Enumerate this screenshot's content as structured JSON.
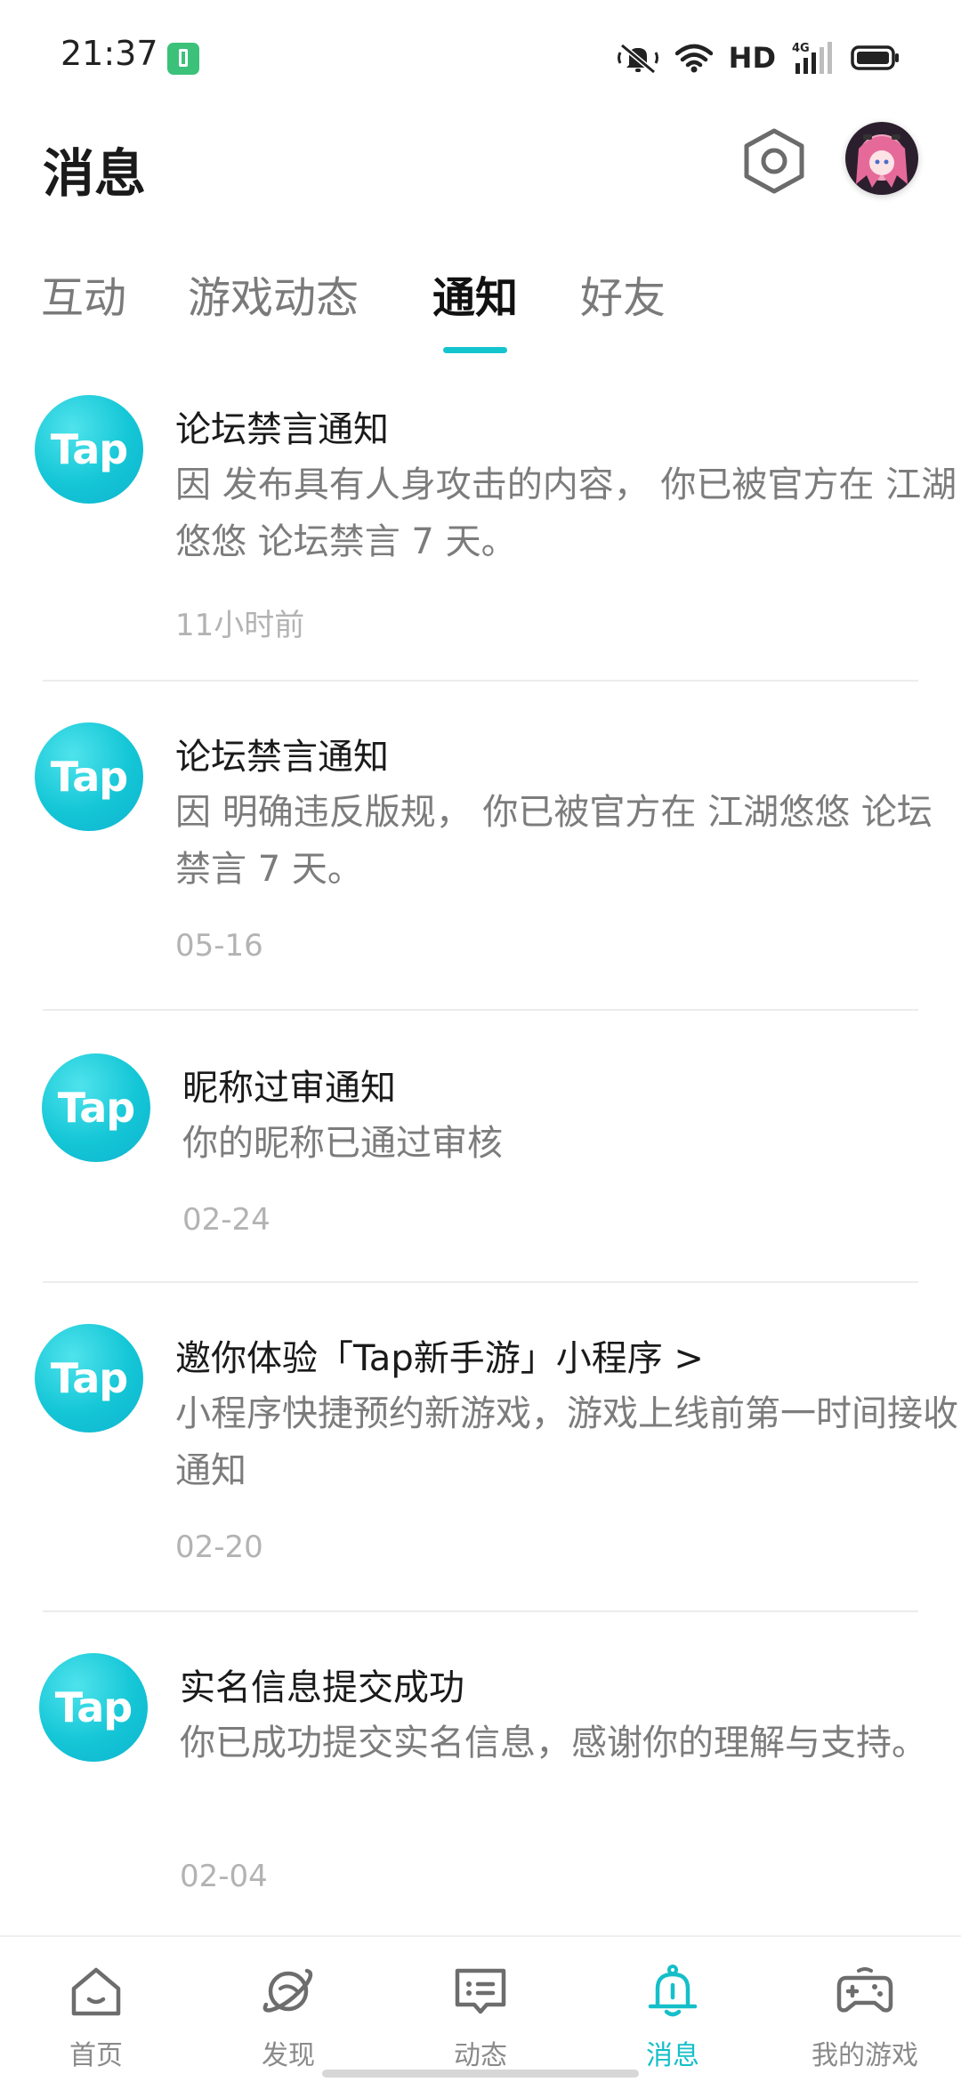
{
  "status_bar": {
    "time": "21:37",
    "network_label": "HD",
    "network_type": "4G",
    "icons": [
      "battery-saver-icon",
      "mute-icon",
      "wifi-icon",
      "signal-icon",
      "battery-icon"
    ]
  },
  "header": {
    "title": "消息",
    "settings_icon": "hexagon-settings-icon",
    "avatar_icon": "user-avatar"
  },
  "tabs": [
    {
      "label": "互动",
      "active": false
    },
    {
      "label": "游戏动态",
      "active": false
    },
    {
      "label": "通知",
      "active": true
    },
    {
      "label": "好友",
      "active": false
    }
  ],
  "notifications": [
    {
      "logo_text": "Tap",
      "title": "论坛禁言通知",
      "body": "因 发布具有人身攻击的内容， 你已被官方在 江湖悠悠 论坛禁言 7 天。",
      "time": "11小时前"
    },
    {
      "logo_text": "Tap",
      "title": "论坛禁言通知",
      "body": "因 明确违反版规， 你已被官方在 江湖悠悠 论坛禁言 7 天。",
      "time": "05-16"
    },
    {
      "logo_text": "Tap",
      "title": "昵称过审通知",
      "body": "你的昵称已通过审核",
      "time": "02-24"
    },
    {
      "logo_text": "Tap",
      "title": "邀你体验「Tap新手游」小程序 >",
      "body": "小程序快捷预约新游戏，游戏上线前第一时间接收通知",
      "time": "02-20"
    },
    {
      "logo_text": "Tap",
      "title": "实名信息提交成功",
      "body": "你已成功提交实名信息，感谢你的理解与支持。",
      "time": "02-04"
    }
  ],
  "bottom_nav": [
    {
      "label": "首页",
      "icon": "home-icon",
      "active": false
    },
    {
      "label": "发现",
      "icon": "planet-icon",
      "active": false
    },
    {
      "label": "动态",
      "icon": "chat-card-icon",
      "active": false
    },
    {
      "label": "消息",
      "icon": "bell-icon",
      "active": true
    },
    {
      "label": "我的游戏",
      "icon": "gamepad-icon",
      "active": false
    }
  ],
  "colors": {
    "accent": "#15c5ce",
    "tap_logo": "#14c6d6",
    "text_primary": "#1a1a1a",
    "text_secondary": "#7c7c7c",
    "text_muted": "#b3b3b3"
  }
}
